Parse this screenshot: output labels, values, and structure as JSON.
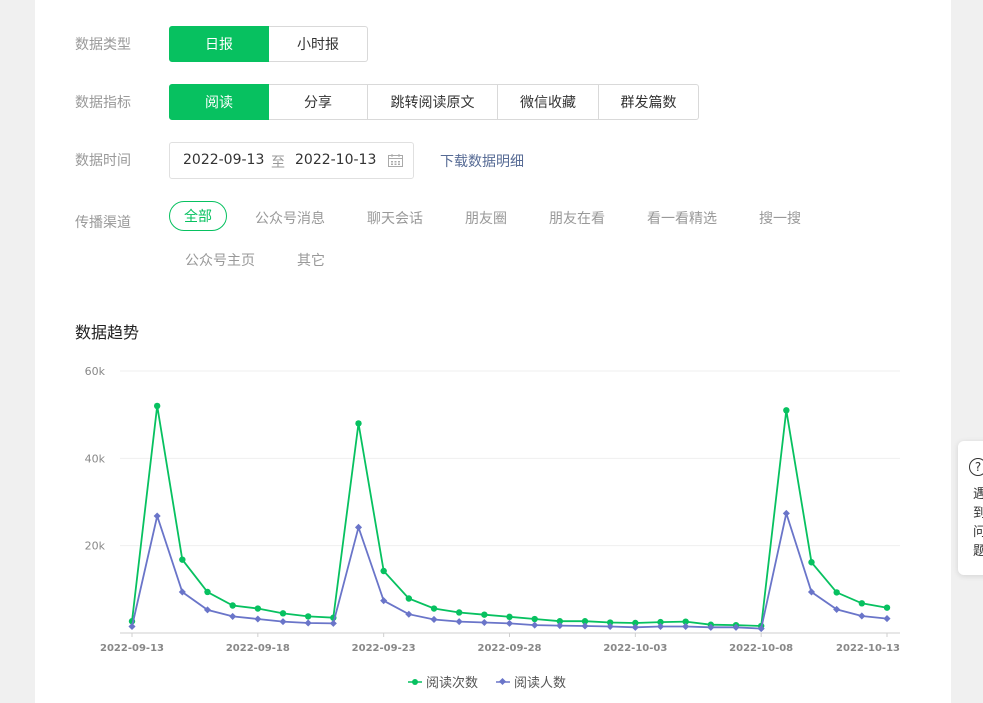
{
  "filters": {
    "data_type": {
      "label": "数据类型",
      "options": [
        "日报",
        "小时报"
      ],
      "selected": "日报"
    },
    "metric": {
      "label": "数据指标",
      "options": [
        "阅读",
        "分享",
        "跳转阅读原文",
        "微信收藏",
        "群发篇数"
      ],
      "selected": "阅读"
    },
    "time": {
      "label": "数据时间",
      "start": "2022-09-13",
      "separator": "至",
      "end": "2022-10-13",
      "download_link": "下载数据明细"
    },
    "channel": {
      "label": "传播渠道",
      "options": [
        "全部",
        "公众号消息",
        "聊天会话",
        "朋友圈",
        "朋友在看",
        "看一看精选",
        "搜一搜",
        "公众号主页",
        "其它"
      ],
      "selected": "全部"
    }
  },
  "trend": {
    "title": "数据趋势"
  },
  "help_panel": {
    "text": "遇到问题"
  },
  "colors": {
    "accent": "#07c160",
    "series_reads": "#07c160",
    "series_readers": "#6a75c9",
    "link": "#576b95"
  },
  "chart_data": {
    "type": "line",
    "ylim": [
      0,
      60000
    ],
    "yticks": [
      20000,
      40000,
      60000
    ],
    "ytick_labels": [
      "20k",
      "40k",
      "60k"
    ],
    "x": [
      "2022-09-13",
      "2022-09-14",
      "2022-09-15",
      "2022-09-16",
      "2022-09-17",
      "2022-09-18",
      "2022-09-19",
      "2022-09-20",
      "2022-09-21",
      "2022-09-22",
      "2022-09-23",
      "2022-09-24",
      "2022-09-25",
      "2022-09-26",
      "2022-09-27",
      "2022-09-28",
      "2022-09-29",
      "2022-09-30",
      "2022-10-01",
      "2022-10-02",
      "2022-10-03",
      "2022-10-04",
      "2022-10-05",
      "2022-10-06",
      "2022-10-07",
      "2022-10-08",
      "2022-10-09",
      "2022-10-10",
      "2022-10-11",
      "2022-10-12",
      "2022-10-13"
    ],
    "xtick_labels": [
      "2022-09-13",
      "2022-09-18",
      "2022-09-23",
      "2022-09-28",
      "2022-10-03",
      "2022-10-08",
      "2022-10-13"
    ],
    "xtick_index": [
      0,
      5,
      10,
      15,
      20,
      25,
      30
    ],
    "series": [
      {
        "name": "阅读次数",
        "values": [
          2700,
          52000,
          16800,
          9400,
          6300,
          5600,
          4500,
          3800,
          3500,
          48000,
          14200,
          7900,
          5600,
          4700,
          4200,
          3700,
          3200,
          2700,
          2700,
          2400,
          2300,
          2500,
          2600,
          1900,
          1800,
          1600,
          51000,
          16200,
          9300,
          6800,
          5800
        ]
      },
      {
        "name": "阅读人数",
        "values": [
          1500,
          26800,
          9400,
          5300,
          3800,
          3200,
          2600,
          2300,
          2200,
          24200,
          7400,
          4300,
          3100,
          2600,
          2400,
          2200,
          1800,
          1700,
          1600,
          1500,
          1300,
          1500,
          1500,
          1300,
          1300,
          1000,
          27400,
          9400,
          5400,
          3900,
          3300
        ]
      }
    ]
  }
}
